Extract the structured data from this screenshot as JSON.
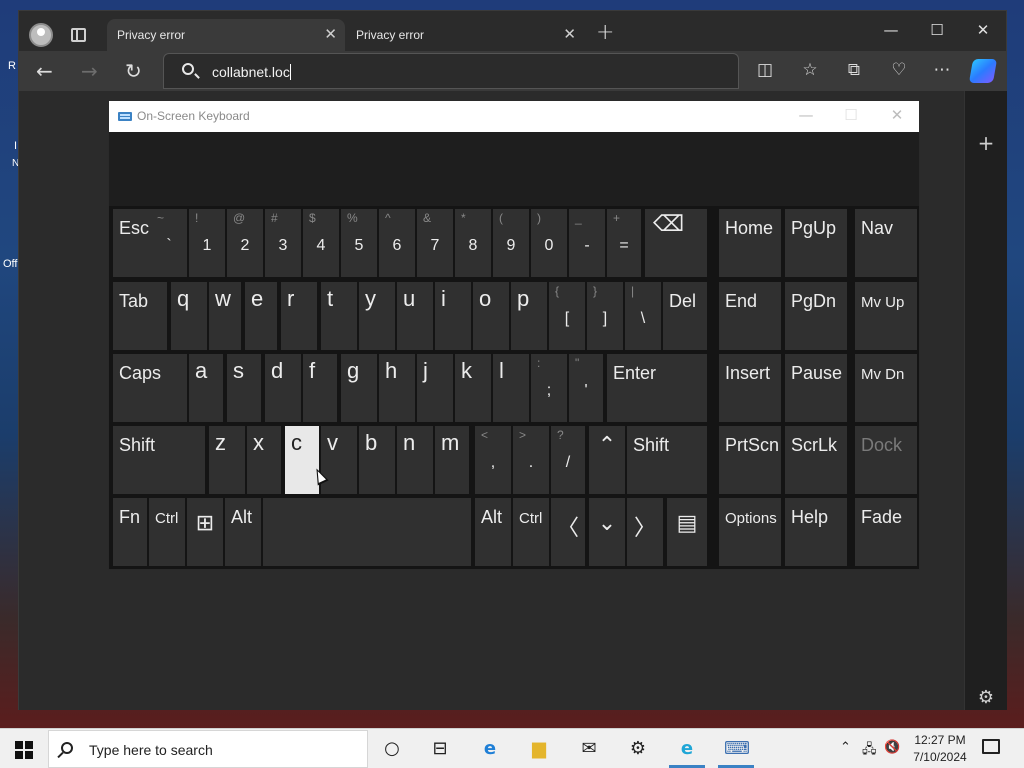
{
  "desktop": {
    "frag_r": "R",
    "frag_i": "I",
    "frag_n": "N",
    "frag_off": "Off"
  },
  "browser": {
    "tabs": [
      {
        "title": "Privacy error",
        "close": "✕"
      },
      {
        "title": "Privacy error",
        "close": "✕"
      }
    ],
    "new_tab": "+",
    "window_controls": {
      "minimize": "—",
      "maximize": "☐",
      "close": "✕"
    },
    "address": "collabnet.loc",
    "sidebar_add": "+",
    "sidebar_settings": "⚙"
  },
  "osk": {
    "title": "On-Screen Keyboard",
    "controls": {
      "minimize": "—",
      "maximize": "☐",
      "close": "✕"
    },
    "rows": {
      "r1": [
        {
          "label": "Esc"
        },
        {
          "shift": "~",
          "main": "`"
        },
        {
          "shift": "!",
          "main": "1"
        },
        {
          "shift": "@",
          "main": "2"
        },
        {
          "shift": "#",
          "main": "3"
        },
        {
          "shift": "$",
          "main": "4"
        },
        {
          "shift": "%",
          "main": "5"
        },
        {
          "shift": "^",
          "main": "6"
        },
        {
          "shift": "&",
          "main": "7"
        },
        {
          "shift": "*",
          "main": "8"
        },
        {
          "shift": "(",
          "main": "9"
        },
        {
          "shift": ")",
          "main": "0"
        },
        {
          "shift": "_",
          "main": "-"
        },
        {
          "shift": "+",
          "main": "="
        },
        {
          "icon": "⌫"
        },
        {
          "label": "Home"
        },
        {
          "label": "PgUp"
        },
        {
          "label": "Nav"
        }
      ],
      "r2": [
        {
          "label": "Tab"
        },
        {
          "main": "q"
        },
        {
          "main": "w"
        },
        {
          "main": "e"
        },
        {
          "main": "r"
        },
        {
          "main": "t"
        },
        {
          "main": "y"
        },
        {
          "main": "u"
        },
        {
          "main": "i"
        },
        {
          "main": "o"
        },
        {
          "main": "p"
        },
        {
          "shift": "{",
          "main": "["
        },
        {
          "shift": "}",
          "main": "]"
        },
        {
          "shift": "|",
          "main": "\\"
        },
        {
          "label": "Del"
        },
        {
          "label": "End"
        },
        {
          "label": "PgDn"
        },
        {
          "label": "Mv Up"
        }
      ],
      "r3": [
        {
          "label": "Caps"
        },
        {
          "main": "a"
        },
        {
          "main": "s"
        },
        {
          "main": "d"
        },
        {
          "main": "f"
        },
        {
          "main": "g"
        },
        {
          "main": "h"
        },
        {
          "main": "j"
        },
        {
          "main": "k"
        },
        {
          "main": "l"
        },
        {
          "shift": ":",
          "main": ";"
        },
        {
          "shift": "\"",
          "main": "'"
        },
        {
          "label": "Enter"
        },
        {
          "label": "Insert"
        },
        {
          "label": "Pause"
        },
        {
          "label": "Mv Dn"
        }
      ],
      "r4": [
        {
          "label": "Shift"
        },
        {
          "main": "z"
        },
        {
          "main": "x"
        },
        {
          "main": "c"
        },
        {
          "main": "v"
        },
        {
          "main": "b"
        },
        {
          "main": "n"
        },
        {
          "main": "m"
        },
        {
          "shift": "<",
          "main": ","
        },
        {
          "shift": ">",
          "main": "."
        },
        {
          "shift": "?",
          "main": "/"
        },
        {
          "icon": "⌃"
        },
        {
          "label": "Shift"
        },
        {
          "label": "PrtScn"
        },
        {
          "label": "ScrLk"
        },
        {
          "label": "Dock"
        }
      ],
      "r5": [
        {
          "label": "Fn"
        },
        {
          "label": "Ctrl"
        },
        {
          "icon": "⊞"
        },
        {
          "label": "Alt"
        },
        {
          "label": ""
        },
        {
          "label": "Alt"
        },
        {
          "label": "Ctrl"
        },
        {
          "icon": "〈"
        },
        {
          "icon": "⌄"
        },
        {
          "icon": "〉"
        },
        {
          "icon": "▤"
        },
        {
          "label": "Options"
        },
        {
          "label": "Help"
        },
        {
          "label": "Fade"
        }
      ]
    },
    "highlighted_key": "c"
  },
  "taskbar": {
    "search_placeholder": "Type here to search",
    "time": "12:27 PM",
    "date": "7/10/2024",
    "tray_up": "⌃"
  }
}
